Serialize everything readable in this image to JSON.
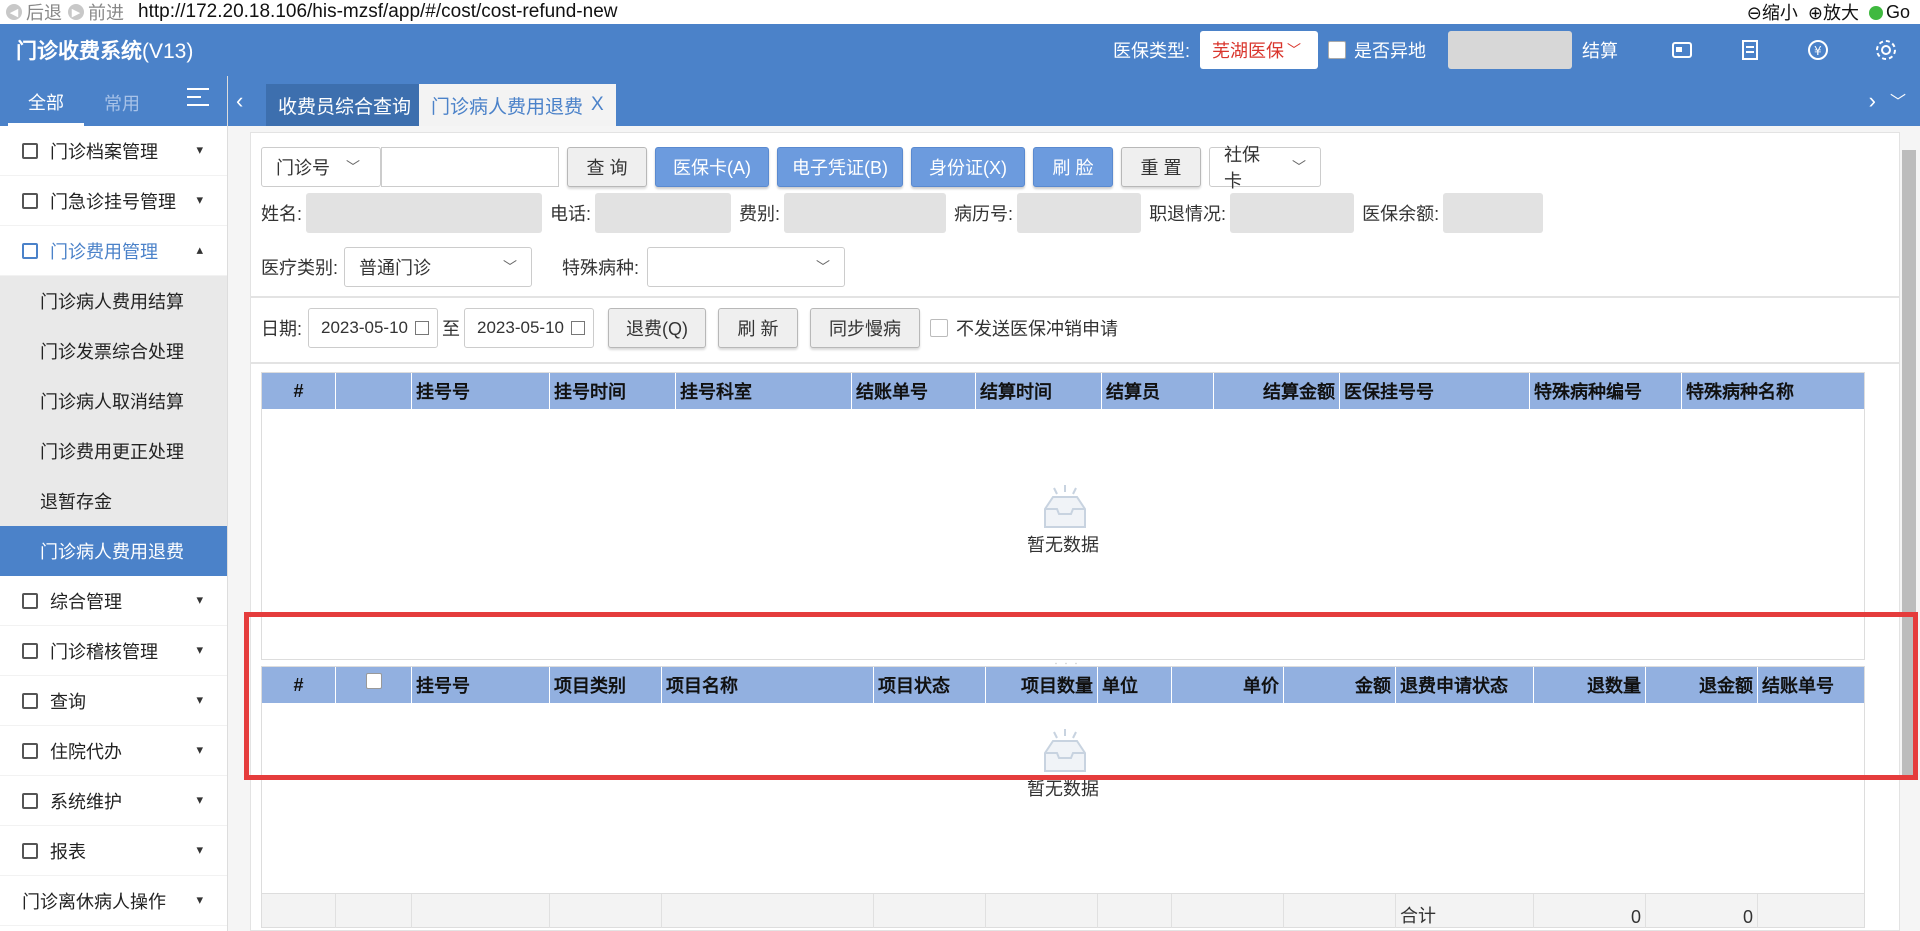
{
  "browser": {
    "back": "后退",
    "forward": "前进",
    "url": "http://172.20.18.106/his-mzsf/app/#/cost/cost-refund-new",
    "zoom_out": "缩小",
    "zoom_in": "放大",
    "go": "Go"
  },
  "header": {
    "title": "门诊收费系统",
    "version": "(V13)",
    "insurance_label": "医保类型:",
    "insurance_value": "芜湖医保",
    "remote_label": "是否异地",
    "settle_label": "结算"
  },
  "sidebar": {
    "tab_all": "全部",
    "tab_common": "常用",
    "items": [
      {
        "label": "门诊档案管理"
      },
      {
        "label": "门急诊挂号管理"
      },
      {
        "label": "门诊费用管理"
      },
      {
        "label": "综合管理"
      },
      {
        "label": "门诊稽核管理"
      },
      {
        "label": "查询"
      },
      {
        "label": "住院代办"
      },
      {
        "label": "系统维护"
      },
      {
        "label": "报表"
      },
      {
        "label": "门诊离休病人操作"
      }
    ],
    "sub_items": [
      {
        "label": "门诊病人费用结算"
      },
      {
        "label": "门诊发票综合处理"
      },
      {
        "label": "门诊病人取消结算"
      },
      {
        "label": "门诊费用更正处理"
      },
      {
        "label": "退暂存金"
      },
      {
        "label": "门诊病人费用退费"
      }
    ]
  },
  "tabs": {
    "tab1": "收费员综合查询",
    "tab2": "门诊病人费用退费",
    "close": "X"
  },
  "search": {
    "id_type": "门诊号",
    "query_btn": "查 询",
    "insurance_card_btn": "医保卡(A)",
    "e_voucher_btn": "电子凭证(B)",
    "id_card_btn": "身份证(X)",
    "face_btn": "刷 脸",
    "reset_btn": "重 置",
    "card_type": "社保卡"
  },
  "patient": {
    "name_label": "姓名:",
    "phone_label": "电话:",
    "fee_label": "费别:",
    "record_label": "病历号:",
    "job_label": "职退情况:",
    "balance_label": "医保余额:",
    "med_type_label": "医疗类别:",
    "med_type_value": "普通门诊",
    "disease_label": "特殊病种:"
  },
  "date_bar": {
    "date_label": "日期:",
    "date_from": "2023-05-10",
    "to": "至",
    "date_to": "2023-05-10",
    "refund_btn": "退费(Q)",
    "refresh_btn": "刷 新",
    "sync_btn": "同步慢病",
    "no_send_label": "不发送医保冲销申请"
  },
  "grid1": {
    "columns": [
      "#",
      "",
      "挂号号",
      "挂号时间",
      "挂号科室",
      "结账单号",
      "结算时间",
      "结算员",
      "结算金额",
      "医保挂号号",
      "特殊病种编号",
      "特殊病种名称"
    ],
    "empty": "暂无数据"
  },
  "grid2": {
    "columns": [
      "#",
      "",
      "挂号号",
      "项目类别",
      "项目名称",
      "项目状态",
      "项目数量",
      "单位",
      "单价",
      "金额",
      "退费申请状态",
      "退数量",
      "退金额",
      "结账单号"
    ],
    "empty": "暂无数据",
    "total_label": "合计",
    "total_qty": "0",
    "total_amount": "0"
  },
  "colors": {
    "primary": "#4b82c9",
    "grid_header": "#92b0e0",
    "highlight": "#e53c3c",
    "insurance_text": "#d9342b"
  }
}
